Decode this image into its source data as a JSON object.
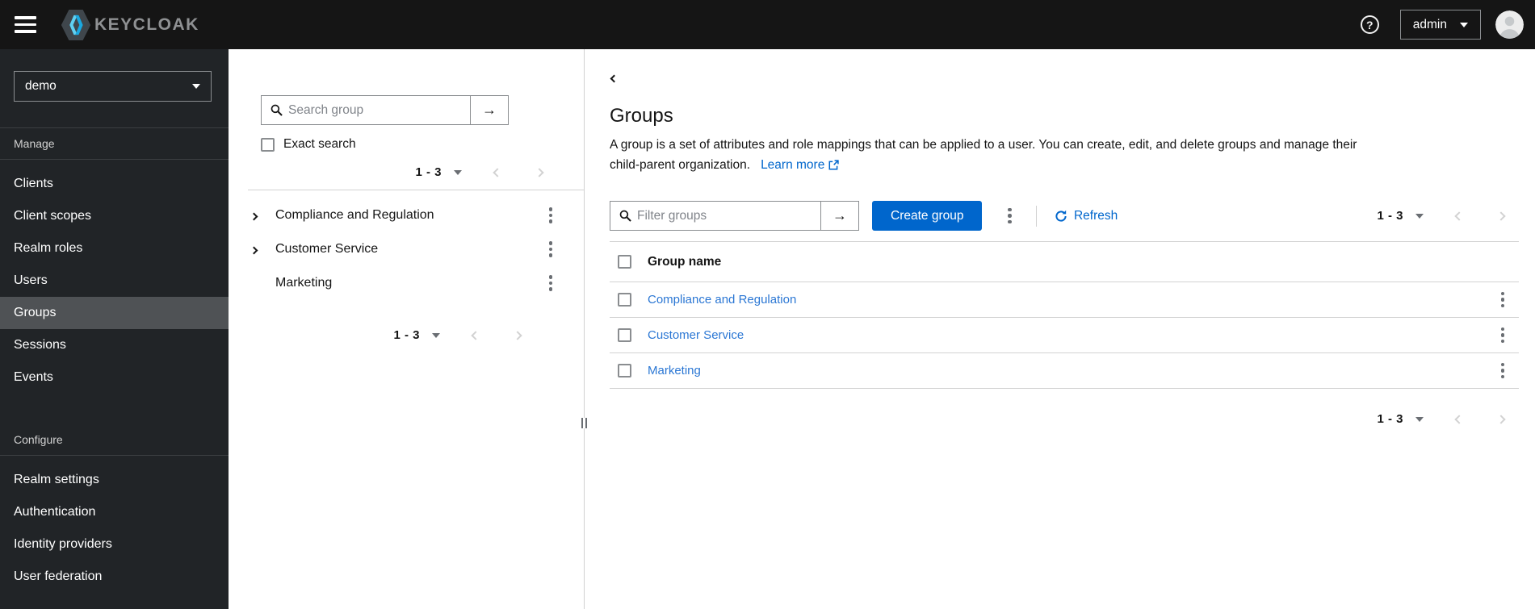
{
  "topbar": {
    "brand": "KEYCLOAK",
    "username": "admin"
  },
  "sidebar": {
    "realm_selected": "demo",
    "sections": [
      {
        "label": "Manage",
        "items": [
          "Clients",
          "Client scopes",
          "Realm roles",
          "Users",
          "Groups",
          "Sessions",
          "Events"
        ],
        "active_item": "Groups"
      },
      {
        "label": "Configure",
        "items": [
          "Realm settings",
          "Authentication",
          "Identity providers",
          "User federation"
        ]
      }
    ]
  },
  "tree_panel": {
    "search_placeholder": "Search group",
    "exact_search_label": "Exact search",
    "exact_search_checked": false,
    "pager_top": "1 - 3",
    "pager_bottom": "1 - 3",
    "groups": [
      {
        "name": "Compliance and Regulation",
        "expandable": true
      },
      {
        "name": "Customer Service",
        "expandable": true
      },
      {
        "name": "Marketing",
        "expandable": false
      }
    ]
  },
  "main": {
    "title": "Groups",
    "description_line1": "A group is a set of attributes and role mappings that can be applied to a user. You can create, edit, and delete groups and manage their",
    "description_line2": "child-parent organization.",
    "learn_more": "Learn more",
    "toolbar": {
      "filter_placeholder": "Filter groups",
      "create_label": "Create group",
      "refresh_label": "Refresh",
      "pager": "1 - 3"
    },
    "table": {
      "columns": [
        "Group name"
      ],
      "rows": [
        {
          "name": "Compliance and Regulation"
        },
        {
          "name": "Customer Service"
        },
        {
          "name": "Marketing"
        }
      ],
      "all_checkboxes_unchecked": true
    },
    "pager_bottom": "1 - 3"
  },
  "colors": {
    "primary_blue": "#0066cc",
    "row_link_blue": "#2b77d4",
    "topbar_bg": "#151515",
    "sidebar_bg": "#212427",
    "sidebar_active_bg": "#4f5255",
    "border_gray": "#d2d2d2"
  }
}
